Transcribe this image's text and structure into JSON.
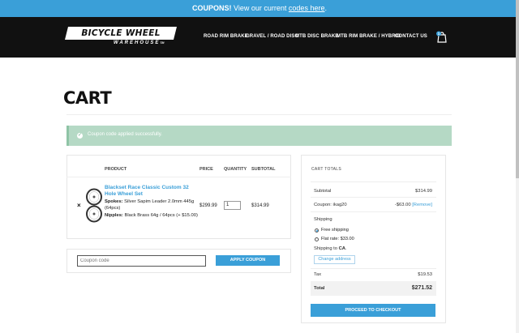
{
  "promo": {
    "lead": "COUPONS!",
    "text": " View our current ",
    "link": "codes here",
    "tail": "."
  },
  "brand": {
    "logo_main": "BICYCLE WHEEL",
    "logo_sub": "WAREHOUSE",
    "logo_tm": "TM"
  },
  "nav": {
    "items": [
      "ROAD RIM BRAKE",
      "GRAVEL / ROAD DISC",
      "MTB DISC BRAKE",
      "MTB RIM BRAKE / HYBRID",
      "CONTACT US"
    ],
    "cart_count": "1"
  },
  "page": {
    "title": "CART"
  },
  "notice": {
    "text": "Coupon code applied successfully."
  },
  "cart": {
    "headers": {
      "product": "PRODUCT",
      "price": "PRICE",
      "quantity": "QUANTITY",
      "subtotal": "SUBTOTAL"
    },
    "item": {
      "remove": "×",
      "name": "Blackset Race Classic Custom 32 Hole Wheel Set",
      "spokes_label": "Spokes:",
      "spokes_value": " Silver Sapim Leader 2.0mm 445g (64pcs)",
      "nipples_label": "Nipples:",
      "nipples_value": " Black Brass 64g / 64pcs (+ $15.00)",
      "price": "$299.99",
      "qty": "1",
      "subtotal": "$314.99"
    },
    "coupon": {
      "placeholder": "Coupon code",
      "button": "APPLY COUPON"
    }
  },
  "totals": {
    "title": "CART TOTALS",
    "subtotal_label": "Subtotal",
    "subtotal_value": "$314.99",
    "coupon_label": "Coupon: ikag20",
    "coupon_value": "-$63.00",
    "coupon_remove": "[Remove]",
    "shipping_label": "Shipping",
    "free_shipping": "Free shipping",
    "flat_rate": "Flat rate: $33.00",
    "shipping_to_prefix": "Shipping to ",
    "shipping_to_value": "CA",
    "shipping_to_suffix": ".",
    "change_address": "Change address",
    "tax_label": "Tax",
    "tax_value": "$19.53",
    "total_label": "Total",
    "total_value": "$271.52",
    "checkout": "PROCEED TO CHECKOUT"
  },
  "colors": {
    "accent": "#3a9fd8",
    "nav_bg": "#111111",
    "notice_bg": "#b5d9c5"
  }
}
